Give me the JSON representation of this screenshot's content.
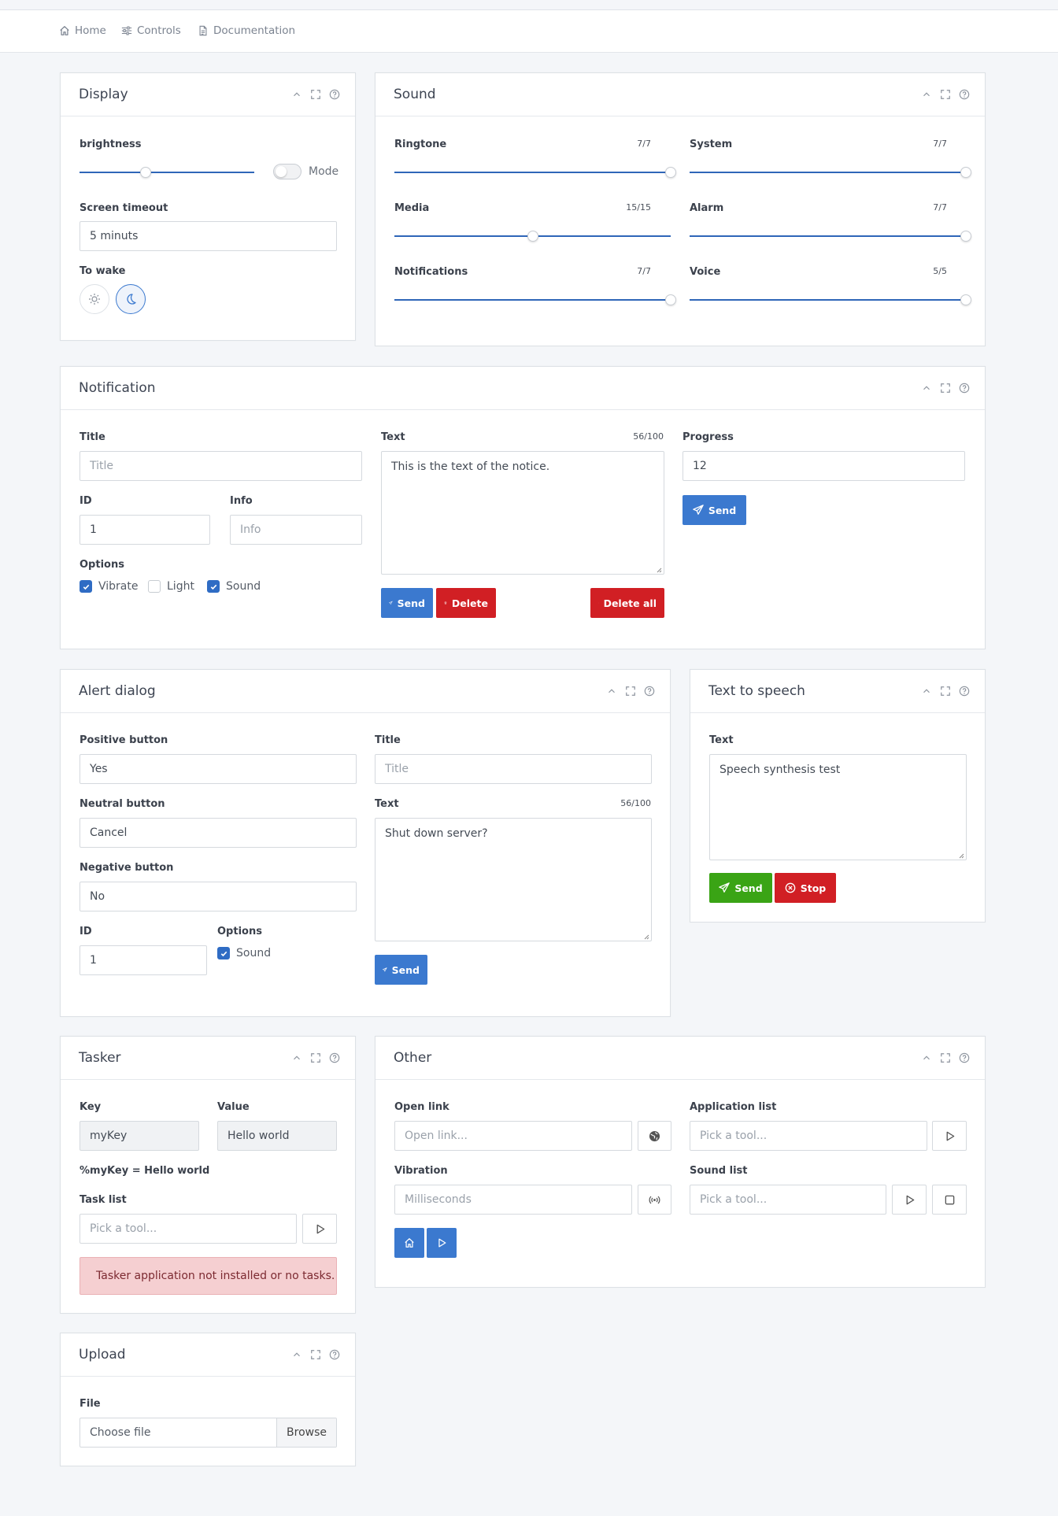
{
  "nav": [
    {
      "label": "Home",
      "icon": "home-icon"
    },
    {
      "label": "Controls",
      "icon": "sliders-icon"
    },
    {
      "label": "Documentation",
      "icon": "document-icon"
    }
  ],
  "colors": {
    "primary": "#3b79cf",
    "danger": "#d11f24",
    "success": "#3aa415",
    "slider": "#2f66b8"
  },
  "display": {
    "title": "Display",
    "brightness_label": "brightness",
    "brightness_level": 0.38,
    "mode_label": "Mode",
    "mode_on": false,
    "timeout_label": "Screen timeout",
    "timeout_value": "5 minuts",
    "wake_label": "To wake",
    "wake_selected": "moon"
  },
  "sound": {
    "title": "Sound",
    "channels": [
      {
        "label": "Ringtone",
        "counter": "7/7",
        "value": 7,
        "max": 7
      },
      {
        "label": "System",
        "counter": "7/7",
        "value": 7,
        "max": 7
      },
      {
        "label": "Media",
        "counter": "15/15",
        "value": 7.5,
        "max": 15
      },
      {
        "label": "Alarm",
        "counter": "7/7",
        "value": 7,
        "max": 7
      },
      {
        "label": "Notifications",
        "counter": "7/7",
        "value": 7,
        "max": 7
      },
      {
        "label": "Voice",
        "counter": "5/5",
        "value": 5,
        "max": 5
      }
    ]
  },
  "notification": {
    "title": "Notification",
    "title_label": "Title",
    "title_placeholder": "Title",
    "id_label": "ID",
    "id_value": "1",
    "info_label": "Info",
    "info_placeholder": "Info",
    "options_label": "Options",
    "options": [
      {
        "label": "Vibrate",
        "checked": true
      },
      {
        "label": "Light",
        "checked": false
      },
      {
        "label": "Sound",
        "checked": true
      }
    ],
    "text_label": "Text",
    "text_counter": "56/100",
    "text_value": "This is the text of the notice.",
    "progress_label": "Progress",
    "progress_value": "12",
    "send_label": "Send",
    "delete_label": "Delete",
    "delete_all_label": "Delete all",
    "progress_send_label": "Send"
  },
  "alert": {
    "title": "Alert dialog",
    "positive_label": "Positive button",
    "positive_value": "Yes",
    "neutral_label": "Neutral button",
    "neutral_value": "Cancel",
    "negative_label": "Negative button",
    "negative_value": "No",
    "id_label": "ID",
    "id_value": "1",
    "options_label": "Options",
    "sound_label": "Sound",
    "sound_checked": true,
    "title_label": "Title",
    "title_placeholder": "Title",
    "text_label": "Text",
    "text_counter": "56/100",
    "text_value": "Shut down server?",
    "send_label": "Send"
  },
  "tts": {
    "title": "Text to speech",
    "text_label": "Text",
    "text_value": "Speech synthesis test",
    "send_label": "Send",
    "stop_label": "Stop"
  },
  "tasker": {
    "title": "Tasker",
    "key_label": "Key",
    "key_value": "myKey",
    "value_label": "Value",
    "value_value": "Hello world",
    "result": "%myKey = Hello world",
    "task_label": "Task list",
    "task_placeholder": "Pick a tool...",
    "alert": "Tasker application not installed or no tasks."
  },
  "other": {
    "title": "Other",
    "open_link_label": "Open link",
    "open_link_placeholder": "Open link...",
    "app_list_label": "Application list",
    "app_list_placeholder": "Pick a tool...",
    "vibration_label": "Vibration",
    "vibration_placeholder": "Milliseconds",
    "sound_list_label": "Sound list",
    "sound_list_placeholder": "Pick a tool..."
  },
  "upload": {
    "title": "Upload",
    "file_label": "File",
    "file_placeholder": "Choose file",
    "browse_label": "Browse"
  }
}
